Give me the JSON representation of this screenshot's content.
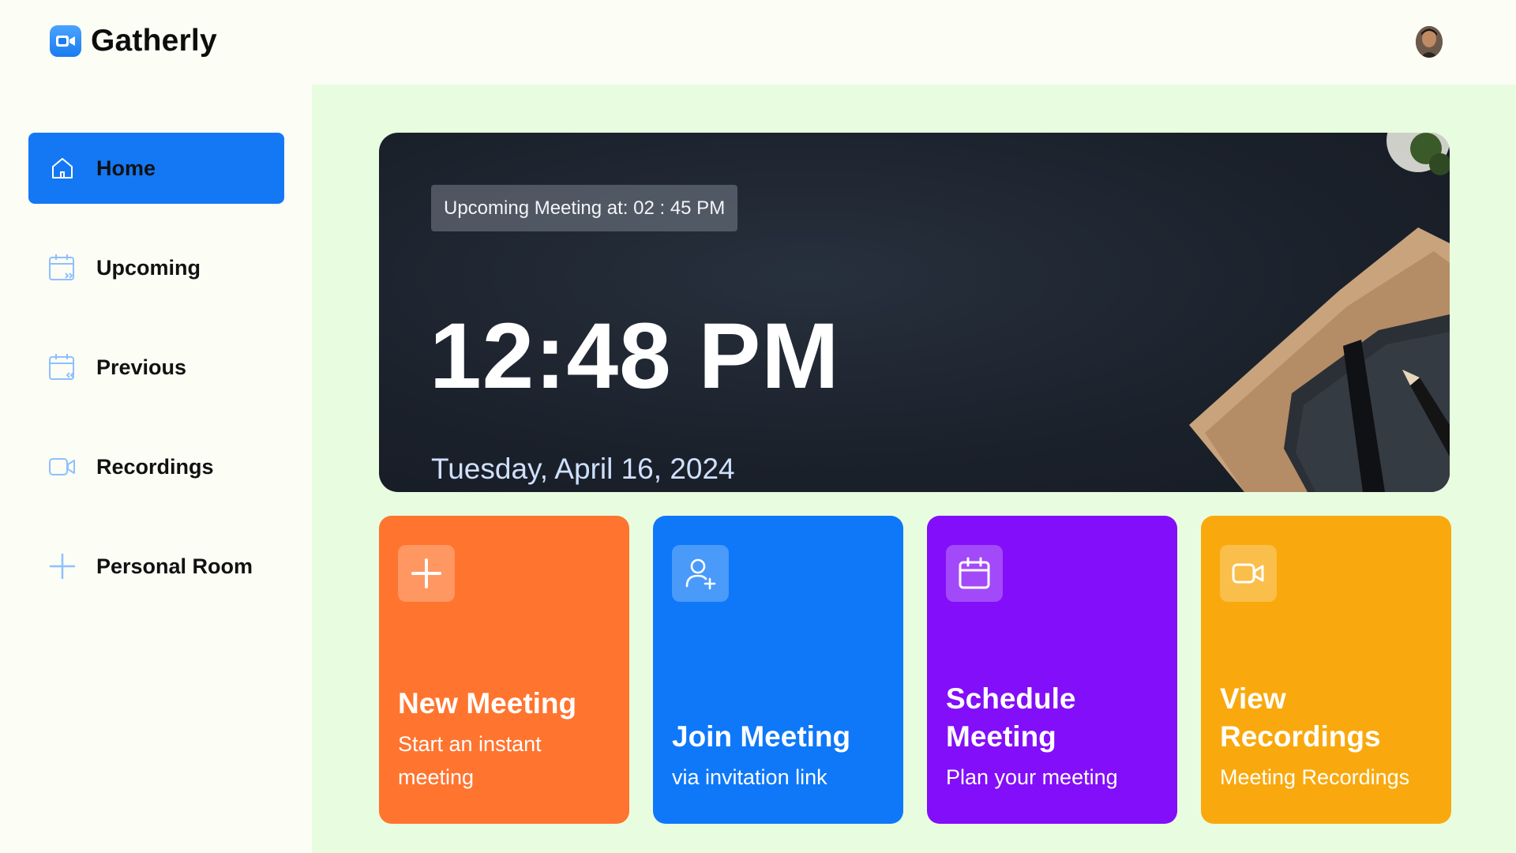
{
  "app": {
    "name": "Gatherly",
    "logo_icon": "video-camera-icon",
    "avatar_icon": "user-avatar"
  },
  "sidebar": {
    "items": [
      {
        "label": "Home",
        "icon": "home-icon",
        "active": true
      },
      {
        "label": "Upcoming",
        "icon": "calendar-forward-icon",
        "active": false
      },
      {
        "label": "Previous",
        "icon": "calendar-back-icon",
        "active": false
      },
      {
        "label": "Recordings",
        "icon": "video-icon",
        "active": false
      },
      {
        "label": "Personal Room",
        "icon": "plus-icon",
        "active": false
      }
    ]
  },
  "hero": {
    "upcoming": "Upcoming Meeting at: 02 : 45 PM",
    "time": "12:48 PM",
    "date": "Tuesday, April 16, 2024"
  },
  "cards": [
    {
      "title": "New Meeting",
      "subtitle": "Start an instant meeting",
      "icon": "plus-icon",
      "color": "#ff742e"
    },
    {
      "title": "Join Meeting",
      "subtitle": "via invitation link",
      "icon": "add-user-icon",
      "color": "#0e78f9"
    },
    {
      "title": "Schedule Meeting",
      "subtitle": "Plan your meeting",
      "icon": "calendar-icon",
      "color": "#830ef9"
    },
    {
      "title": "View Recordings",
      "subtitle": "Meeting Recordings",
      "icon": "video-icon",
      "color": "#f9a90e"
    }
  ],
  "colors": {
    "accent": "#1478f5",
    "main_bg": "#e8fce0",
    "page_bg": "#fcfdf5"
  }
}
